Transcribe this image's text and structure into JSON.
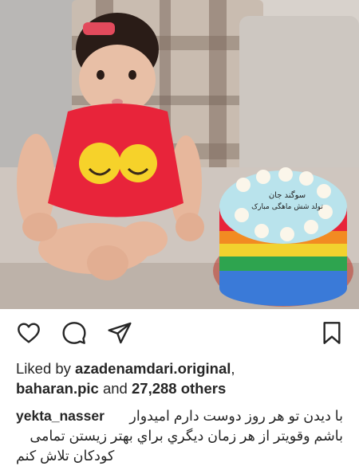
{
  "post": {
    "photo_alt_icon": "photo-baby-with-rainbow-cake",
    "cake_inscription": "سوگند جان\nتولد شش ماهگی مبارک",
    "actions": {
      "like_icon": "heart-icon",
      "comment_icon": "comment-icon",
      "share_icon": "send-icon",
      "save_icon": "bookmark-icon"
    },
    "likes": {
      "prefix": "Liked by ",
      "user1": "azadenamdari.original",
      "separator": ",",
      "user2": "baharan.pic",
      "middle": " and ",
      "count": "27,288 others"
    },
    "caption": {
      "username": "yekta_nasser",
      "line1": "با دیدن تو هر روز دوست دارم امیدوار",
      "line2": "باشم وقویتر از هر زمان دیگري براي بهتر زیستن تمامی",
      "line3": "کودکان تلاش کنم"
    },
    "colors": {
      "text": "#262626",
      "dress": "#e8243a",
      "cake_top": "#b9e3ec"
    }
  }
}
